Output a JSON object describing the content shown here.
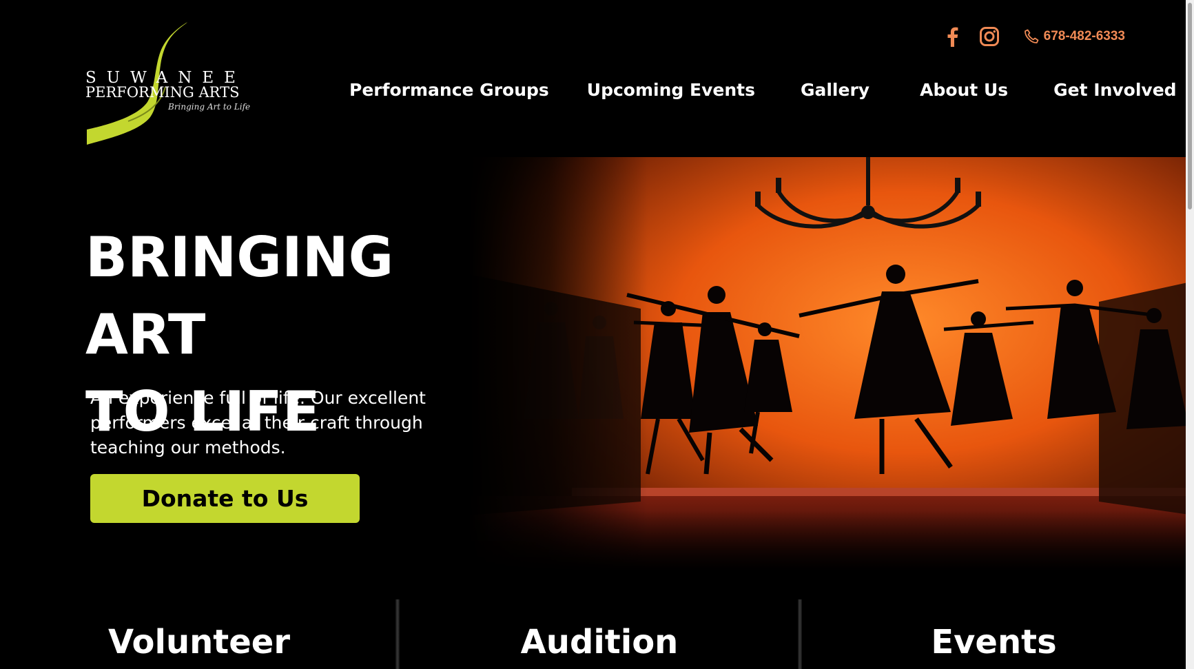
{
  "brand": {
    "line1": "SUWANEE",
    "line2": "PERFORMING ARTS",
    "tagline": "Bringing Art to Life",
    "accent_color": "#c3d72f"
  },
  "topbar": {
    "facebook_icon": "facebook-icon",
    "instagram_icon": "instagram-icon",
    "phone_icon": "phone-icon",
    "phone": "678-482-6333",
    "phone_color": "#f08a55"
  },
  "nav": {
    "items": [
      {
        "label": "Performance Groups"
      },
      {
        "label": "Upcoming Events"
      },
      {
        "label": "Gallery"
      },
      {
        "label": "About Us"
      },
      {
        "label": "Get Involved"
      }
    ]
  },
  "hero": {
    "title_line1": "BRINGING ART",
    "title_line2": "TO LIFE",
    "subtitle": "An experience full of life. Our excellent performers excel at their craft through teaching our methods.",
    "cta_label": "Donate to Us"
  },
  "cards": [
    {
      "title": "Volunteer"
    },
    {
      "title": "Audition"
    },
    {
      "title": "Events"
    }
  ]
}
